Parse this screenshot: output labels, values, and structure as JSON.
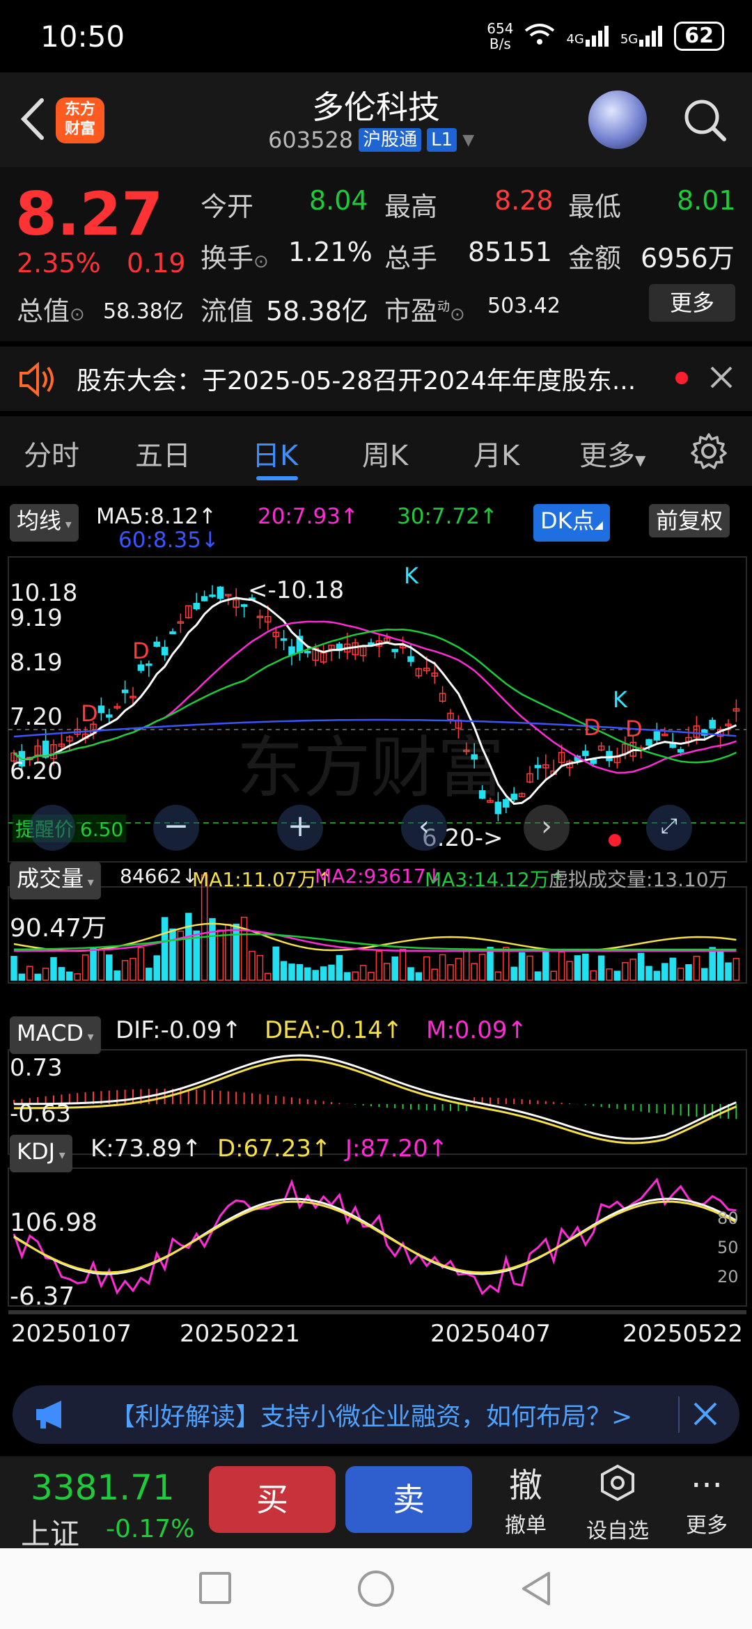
{
  "status": {
    "time": "10:50",
    "net_speed": "654\nB/s",
    "net_speed_top": "654",
    "net_speed_bottom": "B/s",
    "sig1": "4G",
    "sig2": "5G",
    "battery": "62"
  },
  "header": {
    "title": "多伦科技",
    "code": "603528",
    "tag1": "沪股通",
    "tag2": "L1",
    "logo_line1": "东方",
    "logo_line2": "财富"
  },
  "quote": {
    "price": "8.27",
    "pct": "2.35%",
    "chg": "0.19",
    "open_label": "今开",
    "open": "8.04",
    "high_label": "最高",
    "high": "8.28",
    "low_label": "最低",
    "low": "8.01",
    "turnover_label": "换手",
    "turnover": "1.21%",
    "volume_label": "总手",
    "volume": "85151",
    "amount_label": "金额",
    "amount": "6956万",
    "mktcap_label": "总值",
    "mktcap": "58.38亿",
    "float_label": "流值",
    "float": "58.38亿",
    "pe_label": "市盈",
    "pe_sup": "动",
    "pe": "503.42",
    "more": "更多"
  },
  "notice": {
    "text": "股东大会：于2025-05-28召开2024年年度股东..."
  },
  "tabs": [
    "分时",
    "五日",
    "日K",
    "周K",
    "月K",
    "更多"
  ],
  "active_tab": "日K",
  "chart": {
    "ma_chip": "均线",
    "ma5": "MA5:8.12↑",
    "ma20": "20:7.93↑",
    "ma30": "30:7.72↑",
    "ma60": "60:8.35↓",
    "dk_chip": "DK点",
    "fq_chip": "前复权",
    "price_ticks": [
      "10.18",
      "9.19",
      "8.19",
      "7.20",
      "6.20"
    ],
    "high_marker": "<-10.18",
    "low_marker": "6.20->",
    "alert": "提醒价 6.50",
    "vol_chip": "成交量",
    "vol": "84662↓",
    "vol_ma1": "MA1:11.07万↑",
    "vol_ma2": "MA2:93617↓",
    "vol_ma3": "MA3:14.12万↑",
    "vol_virtual": "虚拟成交量:13.10万",
    "vol_tick": "90.47万",
    "macd_chip": "MACD",
    "dif": "DIF:-0.09↑",
    "dea": "DEA:-0.14↑",
    "m": "M:0.09↑",
    "macd_ticks": [
      "0.73",
      "-0.63"
    ],
    "kdj_chip": "KDJ",
    "k": "K:73.89↑",
    "d": "D:67.23↑",
    "j": "J:87.20↑",
    "kdj_ticks": [
      "106.98",
      "-6.37"
    ],
    "kdj_right": [
      "80",
      "50",
      "20"
    ],
    "dates": [
      "20250107",
      "20250221",
      "20250407",
      "20250522"
    ],
    "watermark": "东方财富",
    "signals": [
      "D",
      "K",
      "D",
      "K",
      "D",
      "D"
    ]
  },
  "banner": {
    "text": "【利好解读】支持小微企业融资，如何布局？>"
  },
  "bottom": {
    "index_val": "3381.71",
    "index_name": "上证",
    "index_pct": "-0.17%",
    "buy": "买",
    "sell": "卖",
    "cancel_icon": "撤",
    "cancel": "撤单",
    "watch": "设自选",
    "more": "更多"
  },
  "colors": {
    "up": "#ff3333",
    "down": "#1ecb3a",
    "accent": "#3d8eff"
  }
}
